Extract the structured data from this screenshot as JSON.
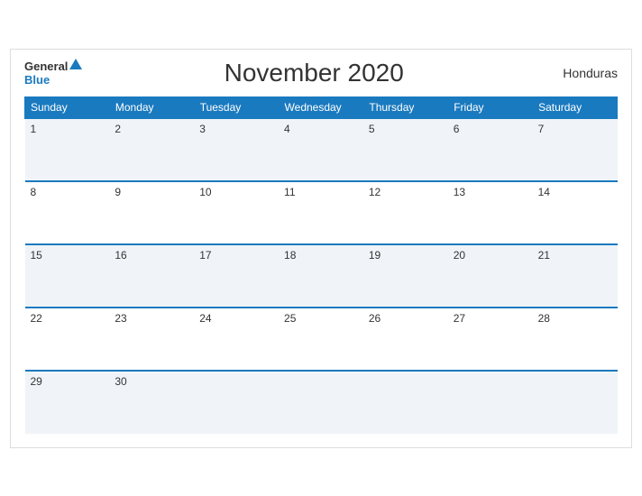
{
  "header": {
    "logo_general": "General",
    "logo_blue": "Blue",
    "title": "November 2020",
    "country": "Honduras"
  },
  "days": {
    "headers": [
      "Sunday",
      "Monday",
      "Tuesday",
      "Wednesday",
      "Thursday",
      "Friday",
      "Saturday"
    ]
  },
  "weeks": [
    [
      "1",
      "2",
      "3",
      "4",
      "5",
      "6",
      "7"
    ],
    [
      "8",
      "9",
      "10",
      "11",
      "12",
      "13",
      "14"
    ],
    [
      "15",
      "16",
      "17",
      "18",
      "19",
      "20",
      "21"
    ],
    [
      "22",
      "23",
      "24",
      "25",
      "26",
      "27",
      "28"
    ],
    [
      "29",
      "30",
      "",
      "",
      "",
      "",
      ""
    ]
  ]
}
